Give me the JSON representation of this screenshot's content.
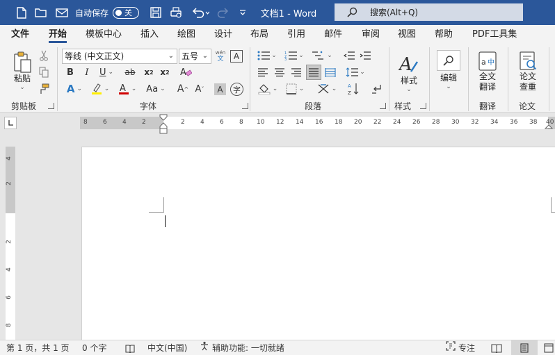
{
  "titlebar": {
    "autosave_label": "自动保存",
    "autosave_state": "关",
    "document_title": "文档1 - Word",
    "search_placeholder": "搜索(Alt+Q)",
    "icons": [
      "new-document-icon",
      "open-folder-icon",
      "email-icon",
      "save-icon",
      "print-preview-icon",
      "undo-icon",
      "redo-icon",
      "customize-qat-icon",
      "search-icon"
    ]
  },
  "tabs": [
    "文件",
    "开始",
    "模板中心",
    "插入",
    "绘图",
    "设计",
    "布局",
    "引用",
    "邮件",
    "审阅",
    "视图",
    "帮助",
    "PDF工具集"
  ],
  "active_tab": "开始",
  "ribbon": {
    "clipboard": {
      "paste_label": "粘贴",
      "group_label": "剪贴板"
    },
    "font": {
      "font_name": "等线 (中文正文)",
      "font_size": "五号",
      "phonetic_top": "wén",
      "phonetic_bottom": "文",
      "change_case_label": "Aa",
      "group_label": "字体"
    },
    "paragraph": {
      "group_label": "段落"
    },
    "styles": {
      "label": "样式",
      "group_label": "样式"
    },
    "editing": {
      "label": "编辑"
    },
    "translate": {
      "label_line1": "全文",
      "label_line2": "翻译",
      "group_label": "翻译"
    },
    "thesis": {
      "label_line1": "论文",
      "label_line2": "查重",
      "group_label": "论文"
    }
  },
  "ruler": {
    "horizontal_ticks": [
      "8",
      "6",
      "4",
      "2",
      "2",
      "4",
      "6",
      "8",
      "10",
      "12",
      "14",
      "16",
      "18",
      "20",
      "22",
      "24",
      "26",
      "28",
      "30",
      "32",
      "34",
      "36",
      "38",
      "40"
    ],
    "vertical_ticks": [
      "4",
      "2",
      "2",
      "4",
      "6",
      "8"
    ]
  },
  "statusbar": {
    "page_info": "第 1 页，共 1 页",
    "word_count": "0 个字",
    "language": "中文(中国)",
    "accessibility": "辅助功能: 一切就绪",
    "focus_label": "专注"
  }
}
